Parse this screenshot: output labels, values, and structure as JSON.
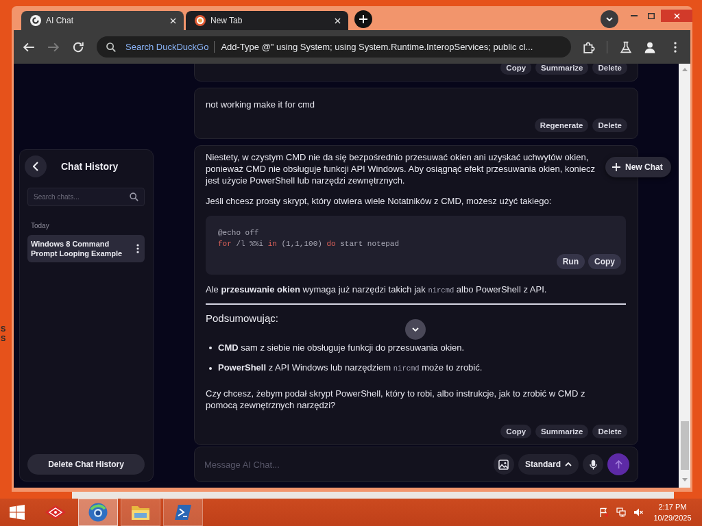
{
  "desktop": {
    "edge_labels": [
      "S",
      "S"
    ]
  },
  "browser": {
    "tabs": [
      {
        "kind": "chat",
        "title": "AI Chat",
        "selected": true
      },
      {
        "kind": "search",
        "title": "New Tab",
        "selected": false
      }
    ],
    "nav": [
      {
        "kind": "back",
        "disabled": false
      },
      {
        "kind": "forward",
        "disabled": true
      },
      {
        "kind": "reload",
        "disabled": false
      }
    ],
    "address_bar": {
      "search_label": "Search DuckDuckGo",
      "value": "Add-Type @\" using System; using System.Runtime.InteropServices; public cl..."
    }
  },
  "sidebar": {
    "title": "Chat History",
    "search": {
      "placeholder": "Search chats..."
    },
    "groups": [
      {
        "label": "Today",
        "items": [
          {
            "title": "Windows 8 Command Prompt Looping Example",
            "selected": true
          }
        ]
      }
    ],
    "delete_button": "Delete Chat History"
  },
  "messages": [
    {
      "kind": "assistant",
      "actions": [
        "Copy",
        "Summarize",
        "Delete"
      ]
    },
    {
      "kind": "user",
      "blocks": [
        {
          "kind": "paragraph",
          "lines": [
            [
              {
                "kind": "text",
                "text": "not working make it for cmd"
              }
            ]
          ]
        }
      ],
      "actions": [
        "Regenerate",
        "Delete"
      ]
    },
    {
      "kind": "assistant",
      "blocks": [
        {
          "kind": "paragraph",
          "lines": [
            [
              {
                "kind": "text",
                "text": "Niestety, w czystym CMD nie da się bezpośrednio przesuwać okien ani uzyskać uchwytów okien,"
              }
            ],
            [
              {
                "kind": "text",
                "text": "ponieważ CMD nie obsługuje funkcji API Windows. Aby osiągnąć efekt przesuwania okien, koniecz"
              }
            ],
            [
              {
                "kind": "text",
                "text": "jest użycie PowerShell lub narzędzi zewnętrznych."
              }
            ]
          ]
        },
        {
          "kind": "paragraph",
          "lines": [
            [
              {
                "kind": "text",
                "text": "Jeśli chcesz prosty skrypt, który otwiera wiele Notatników z CMD, możesz użyć takiego:"
              }
            ]
          ]
        },
        {
          "kind": "code",
          "lines": [
            [
              {
                "kind": "plain",
                "text": "@echo off"
              }
            ],
            [
              {
                "kind": "keyword",
                "text": "for"
              },
              {
                "kind": "plain",
                "text": " /l %%i "
              },
              {
                "kind": "keyword",
                "text": "in"
              },
              {
                "kind": "plain",
                "text": " (1,1,100) "
              },
              {
                "kind": "keyword",
                "text": "do"
              },
              {
                "kind": "plain",
                "text": " start notepad"
              }
            ]
          ],
          "actions": [
            "Run",
            "Copy"
          ]
        },
        {
          "kind": "paragraph",
          "lines": [
            [
              {
                "kind": "text",
                "text": "Ale **przesuwanie okien** wymaga już narzędzi takich jak "
              },
              {
                "kind": "code",
                "text": "nircmd"
              },
              {
                "kind": "text",
                "text": " albo PowerShell z API."
              }
            ]
          ]
        },
        {
          "kind": "divider"
        },
        {
          "kind": "heading",
          "text": "Podsumowując:"
        },
        {
          "kind": "list",
          "items": [
            {
              "parts": [
                {
                  "kind": "text",
                  "text": "**CMD** sam z siebie nie obsługuje funkcji do przesuwania okien."
                }
              ]
            },
            {
              "parts": [
                {
                  "kind": "text",
                  "text": "**PowerShell** z API Windows lub narzędziem "
                },
                {
                  "kind": "code",
                  "text": "nircmd"
                },
                {
                  "kind": "text",
                  "text": " może to zrobić."
                }
              ]
            }
          ]
        },
        {
          "kind": "paragraph",
          "lines": [
            [
              {
                "kind": "text",
                "text": "Czy chcesz, żebym podał skrypt PowerShell, który to robi, albo instrukcje, jak to zrobić w CMD z"
              }
            ],
            [
              {
                "kind": "text",
                "text": "pomocą zewnętrznych narzędzi?"
              }
            ]
          ]
        }
      ],
      "actions": [
        "Copy",
        "Summarize",
        "Delete"
      ]
    }
  ],
  "new_chat_button": "New Chat",
  "composer": {
    "placeholder": "Message AI Chat...",
    "mode": "Standard"
  },
  "taskbar": {
    "apps": [
      {
        "kind": "store",
        "running": false,
        "selected": false
      },
      {
        "kind": "browser",
        "running": true,
        "selected": true
      },
      {
        "kind": "folder",
        "running": true,
        "selected": false
      },
      {
        "kind": "terminal",
        "running": true,
        "selected": false
      }
    ],
    "clock": {
      "time": "2:17 PM",
      "date": "10/29/2025"
    }
  }
}
